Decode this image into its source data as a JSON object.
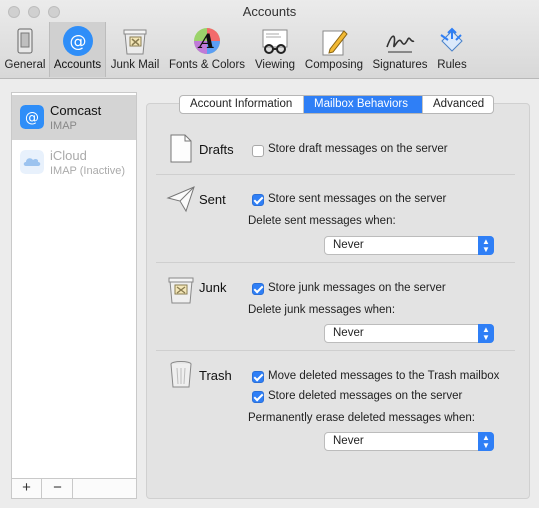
{
  "window": {
    "title": "Accounts"
  },
  "toolbar": {
    "items": [
      {
        "label": "General",
        "icon": "general-icon"
      },
      {
        "label": "Accounts",
        "icon": "accounts-icon",
        "active": true
      },
      {
        "label": "Junk Mail",
        "icon": "junk-mail-icon"
      },
      {
        "label": "Fonts & Colors",
        "icon": "fonts-colors-icon"
      },
      {
        "label": "Viewing",
        "icon": "viewing-icon"
      },
      {
        "label": "Composing",
        "icon": "composing-icon"
      },
      {
        "label": "Signatures",
        "icon": "signatures-icon"
      },
      {
        "label": "Rules",
        "icon": "rules-icon"
      }
    ]
  },
  "sidebar": {
    "accounts": [
      {
        "name": "Comcast",
        "type": "IMAP",
        "selected": true
      },
      {
        "name": "iCloud",
        "type": "IMAP (Inactive)",
        "selected": false
      }
    ],
    "add_label": "+",
    "remove_label": "−"
  },
  "tabs": {
    "items": [
      {
        "label": "Account Information"
      },
      {
        "label": "Mailbox Behaviors",
        "active": true
      },
      {
        "label": "Advanced"
      }
    ]
  },
  "drafts": {
    "title": "Drafts",
    "store_label": "Store draft messages on the server",
    "store_checked": false
  },
  "sent": {
    "title": "Sent",
    "store_label": "Store sent messages on the server",
    "store_checked": true,
    "delete_label": "Delete sent messages when:",
    "delete_value": "Never"
  },
  "junk": {
    "title": "Junk",
    "store_label": "Store junk messages on the server",
    "store_checked": true,
    "delete_label": "Delete junk messages when:",
    "delete_value": "Never"
  },
  "trash": {
    "title": "Trash",
    "move_label": "Move deleted messages to the Trash mailbox",
    "move_checked": true,
    "store_label": "Store deleted messages on the server",
    "store_checked": true,
    "erase_label": "Permanently erase deleted messages when:",
    "erase_value": "Never"
  },
  "colors": {
    "accent": "#2f7ff6"
  }
}
